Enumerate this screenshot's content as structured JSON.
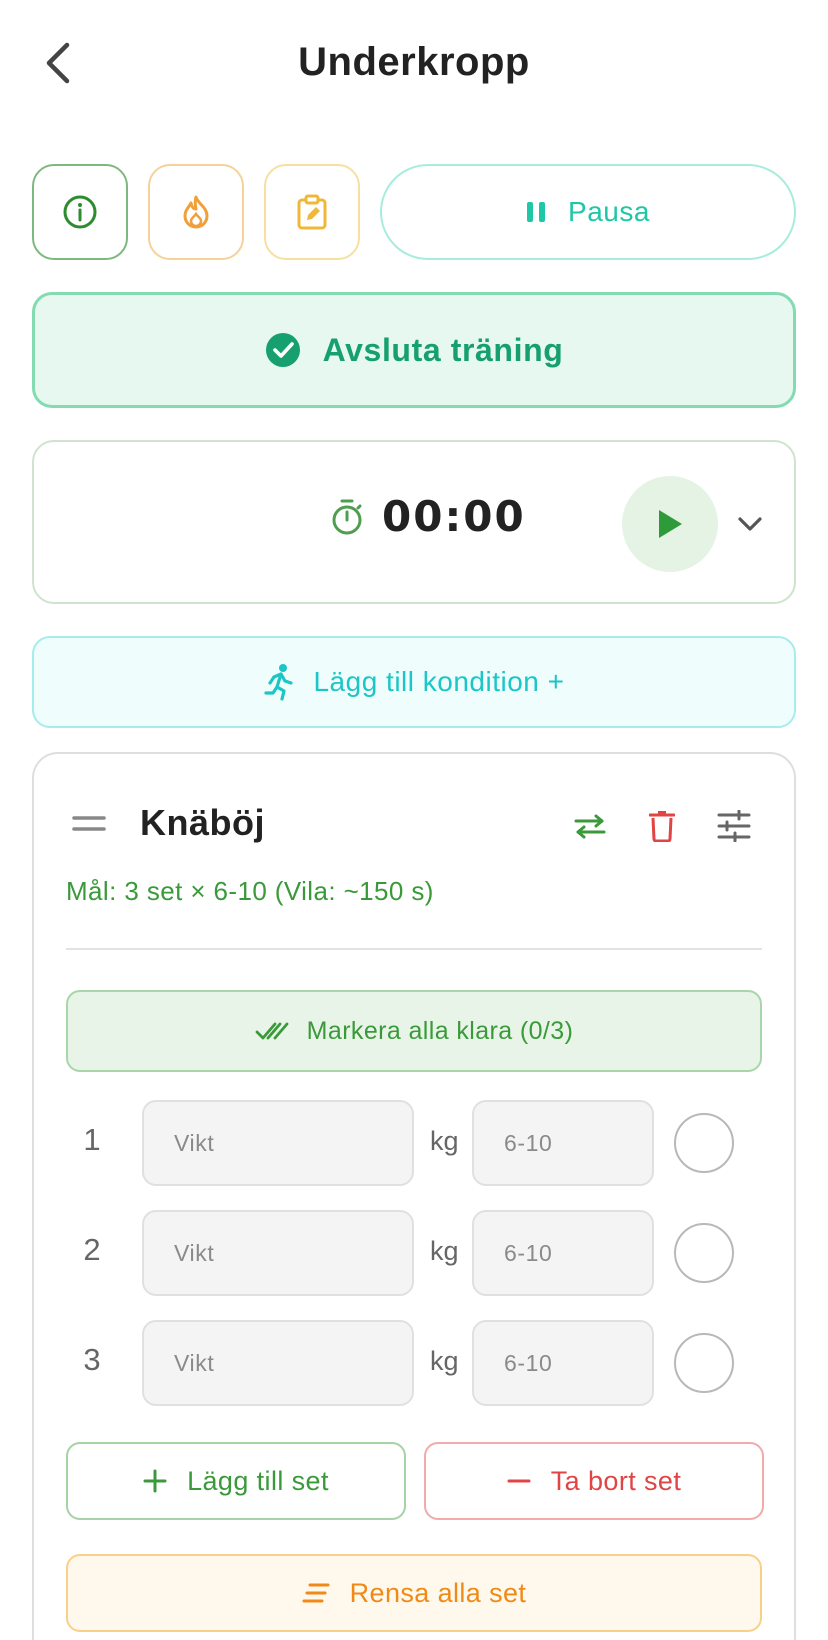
{
  "header": {
    "back_icon": "chevron-left-icon",
    "title": "Underkropp"
  },
  "toolbar": {
    "info_icon": "info-icon",
    "fire_icon": "fire-icon",
    "notes_icon": "clipboard-edit-icon",
    "pause_icon": "pause-icon",
    "pause_label": "Pausa"
  },
  "finish": {
    "icon": "check-circle-icon",
    "label": "Avsluta träning"
  },
  "timer": {
    "icon": "stopwatch-icon",
    "value": "00:00",
    "play_icon": "play-icon",
    "expand_icon": "chevron-down-icon"
  },
  "cardio": {
    "icon": "running-icon",
    "label": "Lägg till kondition +"
  },
  "exercise": {
    "name": "Knäböj",
    "goal": "Mål: 3 set × 6-10 (Vila: ~150 s)",
    "mark_all_label": "Markera alla klara (0/3)",
    "unit": "kg",
    "sets": [
      {
        "number": "1",
        "weight_placeholder": "Vikt",
        "reps_placeholder": "6-10",
        "done": false
      },
      {
        "number": "2",
        "weight_placeholder": "Vikt",
        "reps_placeholder": "6-10",
        "done": false
      },
      {
        "number": "3",
        "weight_placeholder": "Vikt",
        "reps_placeholder": "6-10",
        "done": false
      }
    ],
    "add_set_label": "Lägg till set",
    "remove_set_label": "Ta bort set",
    "clear_label": "Rensa alla set"
  },
  "colors": {
    "green": "#3a9a3a",
    "teal": "#1ec7a5",
    "mint": "#16a06e",
    "cyan": "#1dc6c6",
    "red": "#e04444",
    "orange": "#f08a16"
  }
}
